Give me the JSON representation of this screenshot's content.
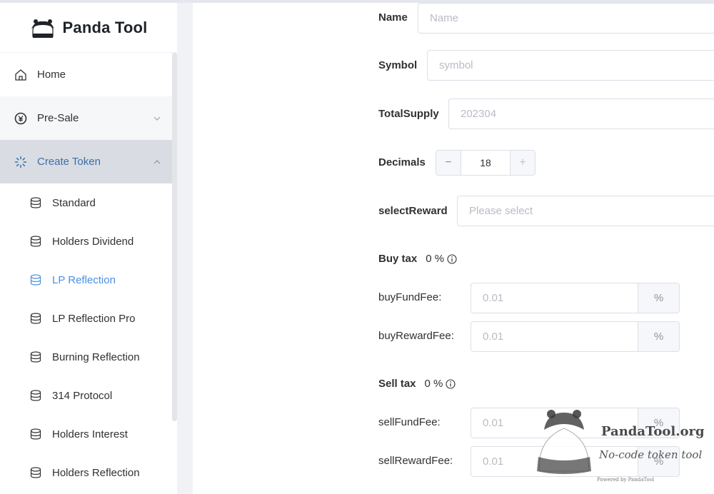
{
  "brand": {
    "name": "Panda Tool"
  },
  "sidebar": {
    "items": [
      {
        "label": "Home",
        "icon": "home-icon"
      },
      {
        "label": "Pre-Sale",
        "icon": "presale-icon"
      },
      {
        "label": "Create Token",
        "icon": "create-token-icon"
      }
    ],
    "subitems": [
      {
        "label": "Standard",
        "icon": "database-icon"
      },
      {
        "label": "Holders Dividend",
        "icon": "database-icon"
      },
      {
        "label": "LP Reflection",
        "icon": "database-icon"
      },
      {
        "label": "LP Reflection Pro",
        "icon": "database-icon"
      },
      {
        "label": "Burning Reflection",
        "icon": "database-icon"
      },
      {
        "label": "314 Protocol",
        "icon": "database-icon"
      },
      {
        "label": "Holders Interest",
        "icon": "database-icon"
      },
      {
        "label": "Holders Reflection",
        "icon": "database-icon"
      }
    ],
    "active_sub": "LP Reflection"
  },
  "form": {
    "name": {
      "label": "Name",
      "placeholder": "Name",
      "value": ""
    },
    "symbol": {
      "label": "Symbol",
      "placeholder": "symbol",
      "value": ""
    },
    "total_supply": {
      "label": "TotalSupply",
      "placeholder": "202304",
      "value": ""
    },
    "decimals": {
      "label": "Decimals",
      "value": "18",
      "minus": "−",
      "plus": "+"
    },
    "select_reward": {
      "label": "selectReward",
      "placeholder": "Please select"
    },
    "buy_tax": {
      "title": "Buy tax",
      "value": "0 %",
      "fund_fee": {
        "label": "buyFundFee:",
        "placeholder": "0.01",
        "unit": "%"
      },
      "reward_fee": {
        "label": "buyRewardFee:",
        "placeholder": "0.01",
        "unit": "%"
      }
    },
    "sell_tax": {
      "title": "Sell tax",
      "value": "0 %",
      "fund_fee": {
        "label": "sellFundFee:",
        "placeholder": "0.01",
        "unit": "%"
      },
      "reward_fee": {
        "label": "sellRewardFee:",
        "placeholder": "0.01",
        "unit": "%"
      }
    }
  },
  "watermark": {
    "name": "PandaTool.org",
    "tagline": "No-code token tool",
    "small": "Powered by PandaTool"
  },
  "colors": {
    "active_text": "#4a90e2",
    "active_parent_bg": "#d9dde3",
    "border": "#dcdfe6"
  }
}
